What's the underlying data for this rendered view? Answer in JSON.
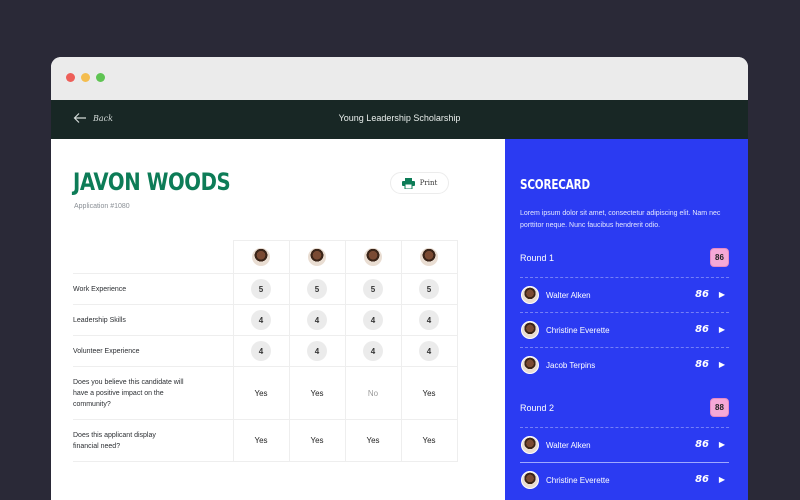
{
  "window": {
    "title": "Young Leadership Scholarship",
    "back_label": "Back"
  },
  "applicant": {
    "name": "JAVON WOODS",
    "application": "Application #1080",
    "print_label": "Print"
  },
  "table": {
    "rows": [
      {
        "label": "Work Experience",
        "scores": [
          "5",
          "5",
          "5",
          "5"
        ]
      },
      {
        "label": "Leadership Skills",
        "scores": [
          "4",
          "4",
          "4",
          "4"
        ]
      },
      {
        "label": "Volunteer Experience",
        "scores": [
          "4",
          "4",
          "4",
          "4"
        ]
      },
      {
        "label": "Does you believe this candidate will have a positive impact on the community?",
        "scores": [
          "Yes",
          "Yes",
          "No",
          "Yes"
        ]
      },
      {
        "label": "Does this applicant display financial need?",
        "scores": [
          "Yes",
          "Yes",
          "Yes",
          "Yes"
        ]
      }
    ]
  },
  "scorecard": {
    "title": "SCORECARD",
    "description": "Lorem ipsum dolor sit amet, consectetur adipiscing elit. Nam nec porttitor neque. Nunc faucibus hendrerit odio.",
    "rounds": [
      {
        "label": "Round 1",
        "score": "86",
        "judges": [
          {
            "name": "Walter Alken",
            "score": "86"
          },
          {
            "name": "Christine Everette",
            "score": "86"
          },
          {
            "name": "Jacob Terpins",
            "score": "86"
          }
        ]
      },
      {
        "label": "Round 2",
        "score": "88",
        "judges": [
          {
            "name": "Walter Alken",
            "score": "86"
          },
          {
            "name": "Christine Everette",
            "score": "86"
          }
        ]
      }
    ]
  },
  "colors": {
    "brand_green": "#0d7c57",
    "sidebar_blue": "#2b3bf2",
    "badge_pink": "#f6a8d7",
    "appbar": "#182725"
  }
}
